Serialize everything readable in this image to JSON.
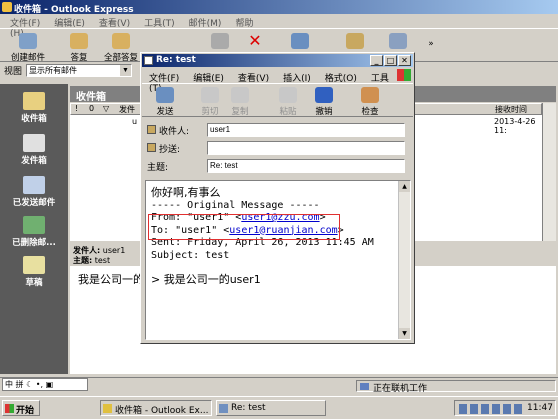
{
  "main": {
    "title": "收件箱 - Outlook Express",
    "menu": [
      "文件(F)",
      "编辑(E)",
      "查看(V)",
      "工具(T)",
      "邮件(M)",
      "帮助(H)"
    ],
    "toolbar": [
      "创建邮件",
      "答复",
      "全部答复"
    ],
    "view_label": "视图",
    "view_value": "显示所有邮件",
    "folder_header": "收件箱",
    "col_headers": [
      "!",
      "0",
      "▽",
      "发件"
    ],
    "col_received": "接收时间",
    "row": {
      "from_fragment": "u",
      "received": "2013-4-26 11:"
    },
    "sidebar": [
      "收件箱",
      "发件箱",
      "已发送邮件",
      "已删除邮...",
      "草稿"
    ],
    "preview": {
      "from_label": "发件人:",
      "from": "user1",
      "subject_label": "主题:",
      "subject": "test",
      "body": "我是公司一的"
    },
    "status": "正在联机工作"
  },
  "reply": {
    "title": "Re: test",
    "menu": [
      "文件(F)",
      "编辑(E)",
      "查看(V)",
      "插入(I)",
      "格式(O)",
      "工具(T)"
    ],
    "toolbar": [
      "发送",
      "剪切",
      "复制",
      "粘贴",
      "撤销",
      "检查"
    ],
    "to_label": "收件人:",
    "to": "user1",
    "cc_label": "抄送:",
    "cc": "",
    "subject_label": "主题:",
    "subject": "Re: test",
    "body": {
      "line1": "你好啊,有事么",
      "orig": "----- Original Message -----",
      "from_prefix": "From: \"user1\" <",
      "from_email": "user1@zzu.com",
      "to_prefix": "To: \"user1\" <",
      "to_email": "user1@ruanjian.com",
      "close": ">",
      "sent": "Sent: Friday, April 26, 2013 11:45 AM",
      "subj": "Subject: test",
      "quote": "> 我是公司一的user1"
    }
  },
  "taskbar": {
    "start": "开始",
    "tasks": [
      "收件箱 - Outlook Ex...",
      "Re: test"
    ],
    "time": "11:47"
  },
  "colors": {
    "title": "#0a246a",
    "sidebar": "#5a5a5a",
    "highlight": "#e03030",
    "link": "#0000cc"
  }
}
